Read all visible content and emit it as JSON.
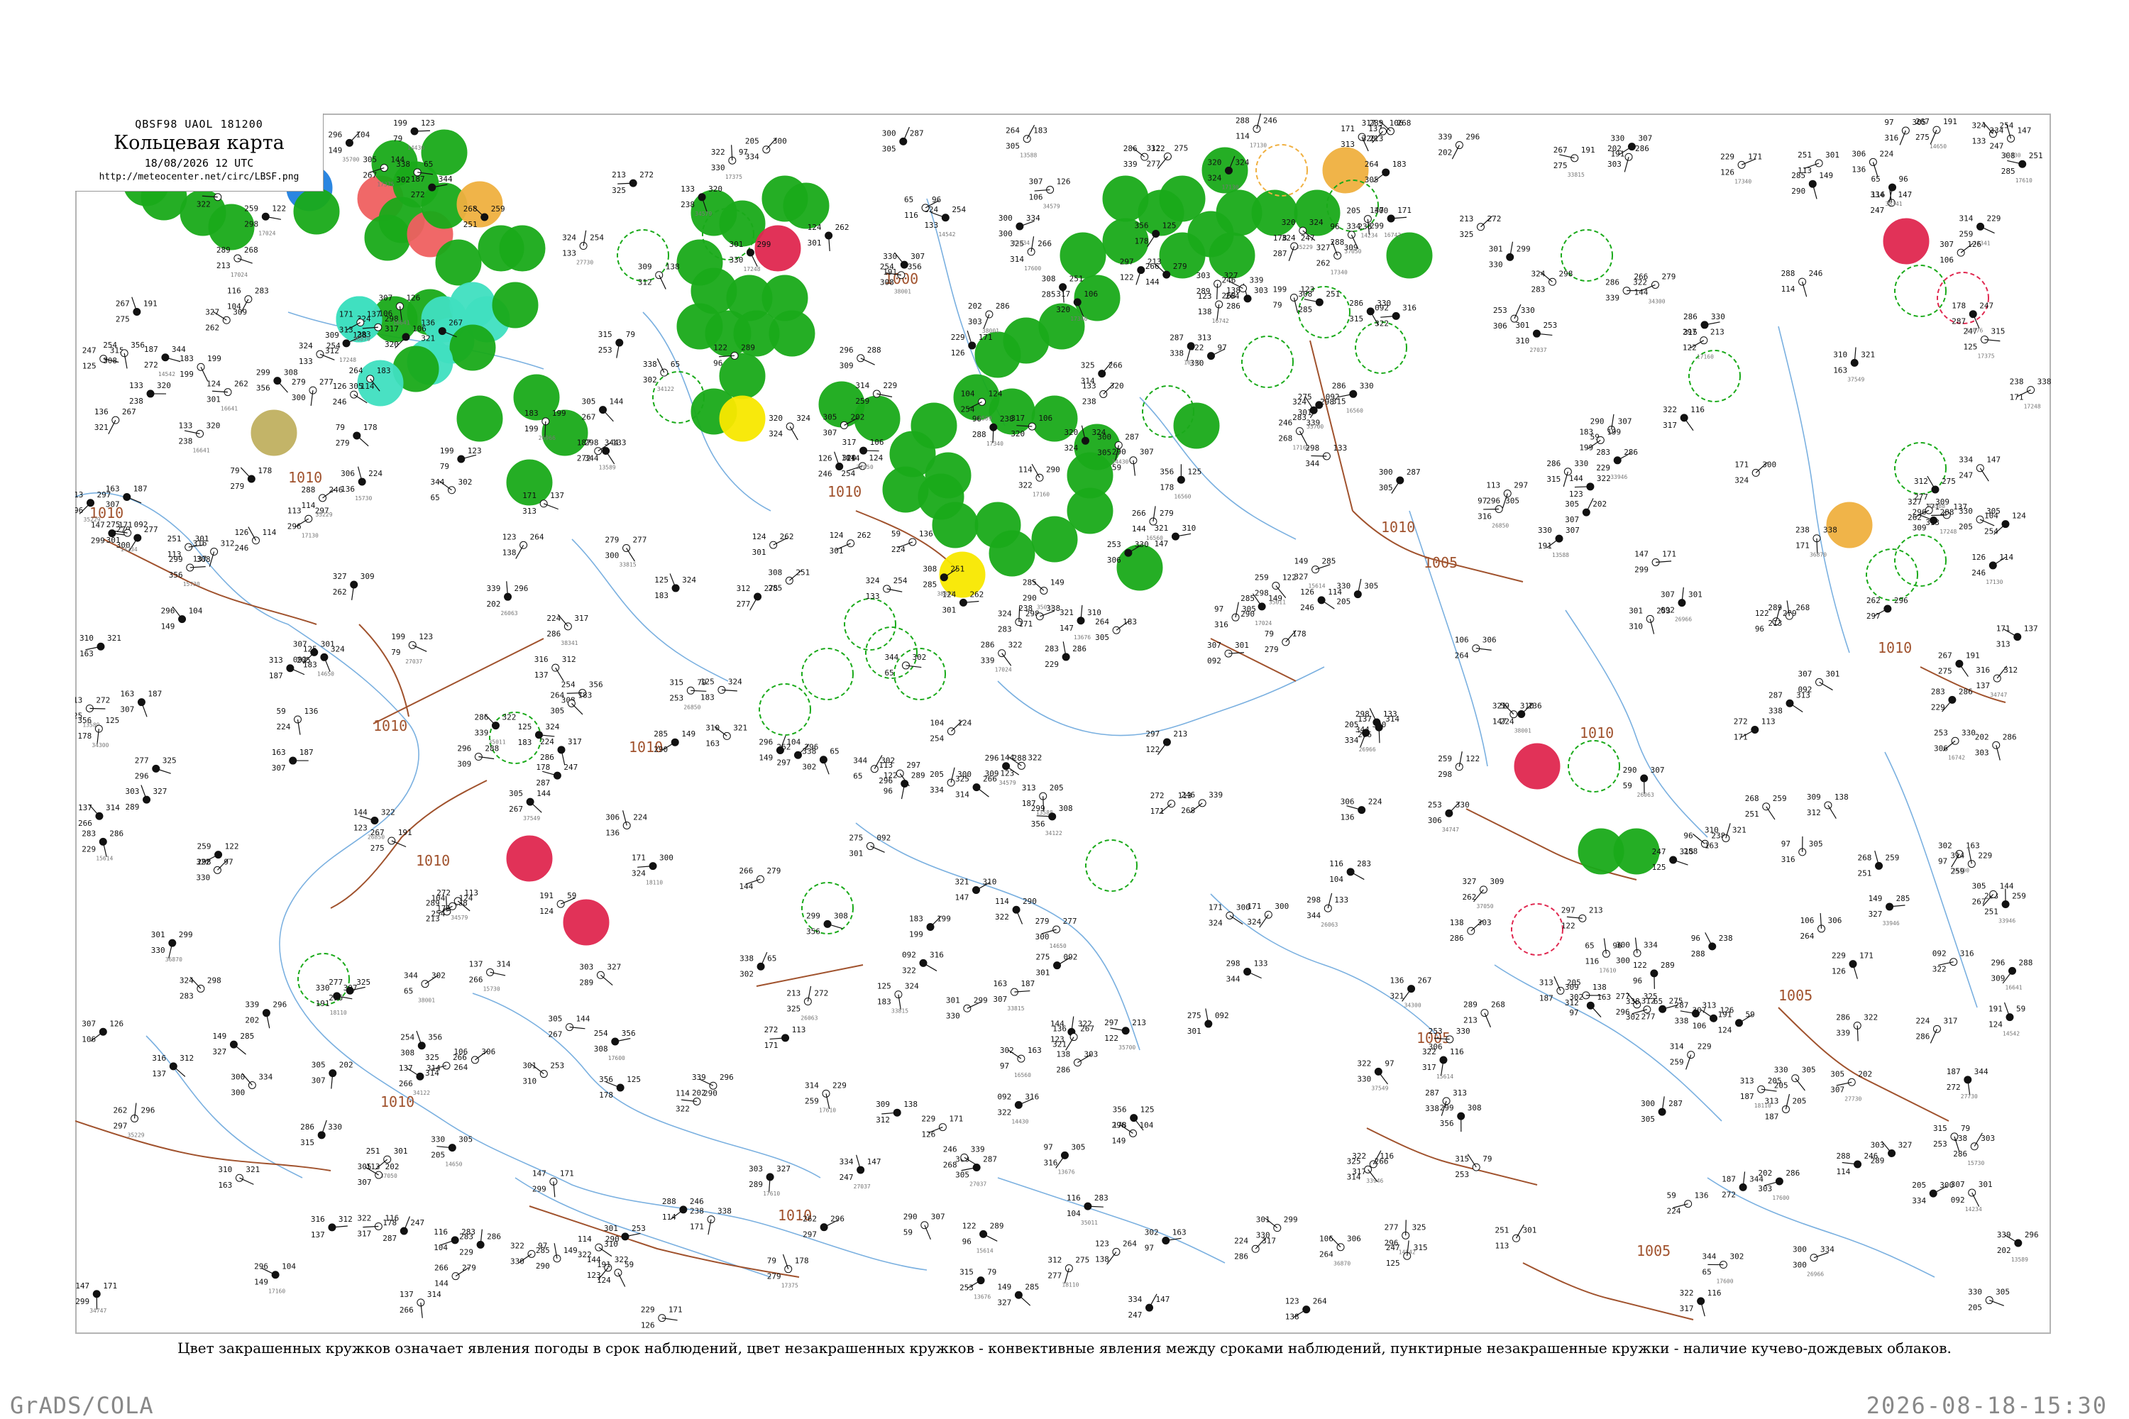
{
  "header": {
    "code_line": "QBSF98  UAOL  181200",
    "title": "Кольцевая карта",
    "valid_time": "18/08/2026 12 UTC",
    "source_url": "http://meteocenter.net/circ/LBSF.png"
  },
  "legend_note": "Цвет закрашенных кружков означает явления погоды в срок наблюдений, цвет незакрашенных кружков - конвективные явления между сроками наблюдений, пунктирные незакрашенные кружки - наличие кучево-дождевых облаков.",
  "footer": {
    "software": "GrADS/COLA",
    "timestamp": "2026-08-18-15:30"
  },
  "colors": {
    "isobar": "#a0522d",
    "river": "#7ab0e0",
    "coast": "#7ab0e0",
    "rain_green": "#1aaa1a",
    "thunder_red": "#e02850",
    "light_red": "#f06060",
    "orange": "#f0b040",
    "yellow": "#f8e800",
    "cyan": "#40e0c0",
    "blue": "#2080e0",
    "olive": "#c0b060"
  },
  "isobar_labels": [
    {
      "text": "1010"
    },
    {
      "text": "1010"
    },
    {
      "text": "1010"
    },
    {
      "text": "1010"
    },
    {
      "text": "1010"
    },
    {
      "text": "1010"
    },
    {
      "text": "1010"
    },
    {
      "text": "1010"
    },
    {
      "text": "1005"
    },
    {
      "text": "1005"
    },
    {
      "text": "1005"
    },
    {
      "text": "1010"
    },
    {
      "text": "1010"
    },
    {
      "text": "1005"
    },
    {
      "text": "1000"
    },
    {
      "text": "1010"
    }
  ],
  "station_readings": [
    "313",
    "104",
    "97",
    "205",
    "092",
    "187",
    "125",
    "122",
    "137",
    "266",
    "124",
    "147",
    "285",
    "126",
    "296",
    "171",
    "229",
    "305",
    "254",
    "303",
    "312",
    "339",
    "144",
    "307",
    "300",
    "305",
    "267",
    "322",
    "338",
    "356",
    "307",
    "316",
    "286",
    "320",
    "324",
    "301",
    "327",
    "310",
    "344",
    "308",
    "264",
    "298",
    "315",
    "275",
    "334",
    "324",
    "330",
    "283",
    "299",
    "286",
    "296",
    "253",
    "289",
    "288",
    "297",
    "309",
    "317",
    "322",
    "325",
    "314",
    "330",
    "290",
    "321",
    "300",
    "301",
    "277",
    "279",
    "268",
    "306",
    "302",
    "272",
    "287",
    "259",
    "262",
    "246",
    "238",
    "251",
    "247",
    "202",
    "224",
    "171",
    "213",
    "178",
    "183",
    "199",
    "191",
    "163",
    "149",
    "138",
    "136",
    "133",
    "123",
    "116",
    "113",
    "114",
    "106",
    "96",
    "79",
    "59",
    "65"
  ],
  "station_ids": [
    "13588",
    "13589",
    "13676",
    "14234",
    "14430",
    "14542",
    "14650",
    "15614",
    "15730",
    "16560",
    "16641",
    "16742",
    "17024",
    "17130",
    "17160",
    "17248",
    "17340",
    "17375",
    "17600",
    "17610",
    "18110",
    "26063",
    "26850",
    "26966",
    "27037",
    "27730",
    "33815",
    "33946",
    "34122",
    "34300",
    "34579",
    "34747",
    "35011",
    "35229",
    "35700",
    "36870",
    "37050",
    "37549",
    "38001",
    "38341"
  ]
}
